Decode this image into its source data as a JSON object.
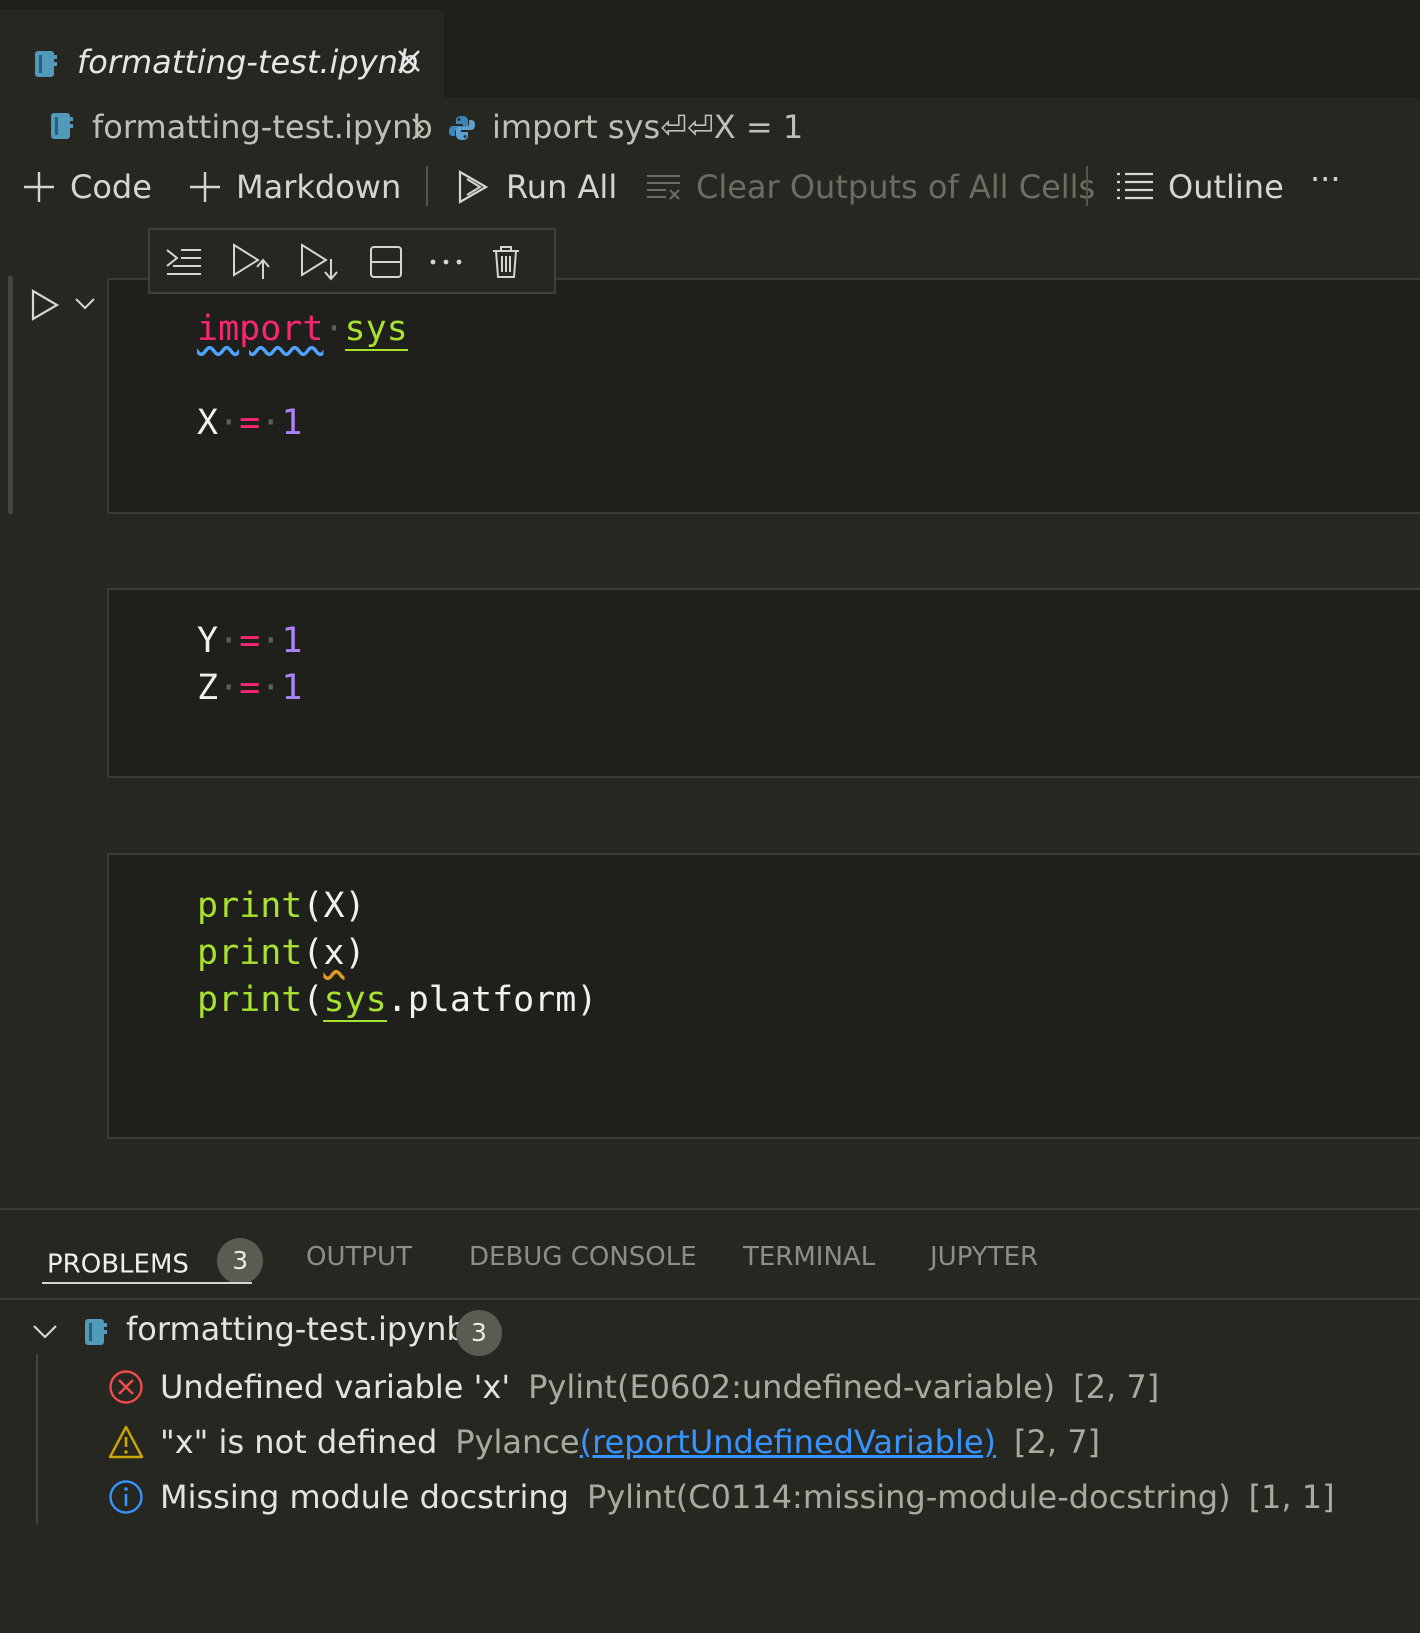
{
  "tab": {
    "title": "formatting-test.ipynb"
  },
  "breadcrumb": {
    "file": "formatting-test.ipynb",
    "symbol": "import sys⏎⏎X = 1"
  },
  "toolbar": {
    "code": "Code",
    "markdown": "Markdown",
    "run_all": "Run All",
    "clear_outputs": "Clear Outputs of All Cells",
    "outline": "Outline",
    "more": "···"
  },
  "cells": {
    "cell1": {
      "l1_kw": "import",
      "l1_mod": "sys",
      "l2_var": "X",
      "l2_op": "=",
      "l2_num": "1"
    },
    "cell2": {
      "l1_var": "Y",
      "l1_op": "=",
      "l1_num": "1",
      "l2_var": "Z",
      "l2_op": "=",
      "l2_num": "1"
    },
    "cell3": {
      "fn": "print",
      "l1_arg": "X",
      "l2_arg": "x",
      "l3_mod": "sys",
      "l3_attr": ".platform"
    },
    "paren_open": "(",
    "paren_close": ")",
    "ws_dot": "·"
  },
  "panel": {
    "tabs": [
      "PROBLEMS",
      "OUTPUT",
      "DEBUG CONSOLE",
      "TERMINAL",
      "JUPYTER"
    ],
    "problems_count": "3",
    "file": {
      "name": "formatting-test.ipynb",
      "count": "3"
    },
    "problems": [
      {
        "severity": "error",
        "icon": "error-circle-icon",
        "message": "Undefined variable 'x'",
        "source": "Pylint(E0602:undefined-variable)",
        "position": "[2, 7]"
      },
      {
        "severity": "warning",
        "icon": "warning-triangle-icon",
        "message": "\"x\" is not defined",
        "source": "Pylance",
        "link": "(reportUndefinedVariable)",
        "position": "[2, 7]"
      },
      {
        "severity": "info",
        "icon": "info-circle-icon",
        "message": "Missing module docstring",
        "source": "Pylint(C0114:missing-module-docstring)",
        "position": "[1, 1]"
      }
    ]
  },
  "colors": {
    "background": "#262721",
    "cell_background": "#1f201b",
    "keyword": "#f92672",
    "function": "#a6e22e",
    "number": "#ae81ff",
    "link": "#3794ff",
    "error": "#f14c4c",
    "warning": "#cca700",
    "info": "#3794ff"
  }
}
